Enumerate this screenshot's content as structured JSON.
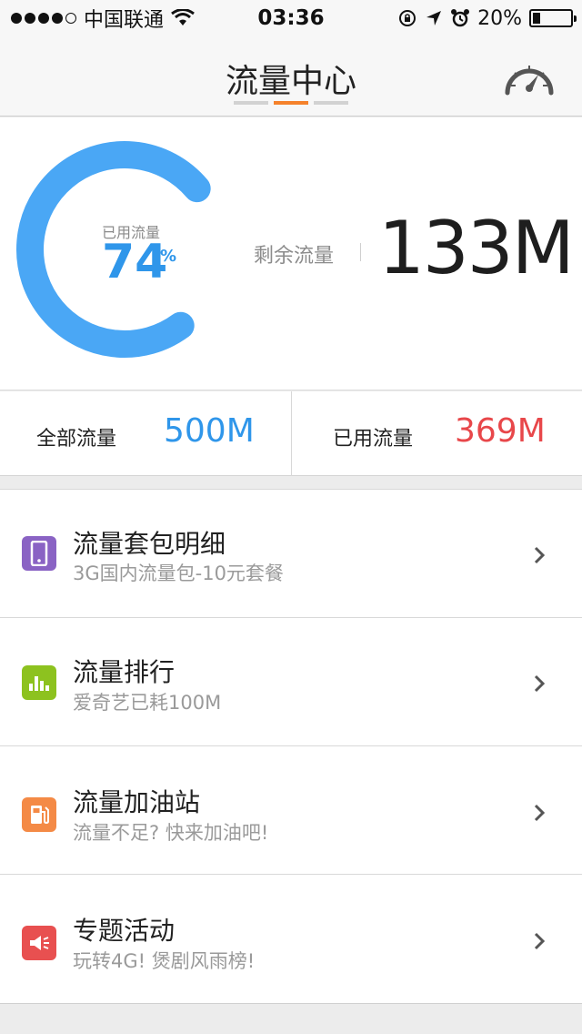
{
  "status_bar": {
    "carrier": "中国联通",
    "time": "03:36",
    "battery": "20%",
    "battery_level": 0.2
  },
  "nav": {
    "title": "流量中心",
    "page_count": 3,
    "active_page": 2
  },
  "usage": {
    "used_caption": "已用流量",
    "used_percent": "74",
    "percent_sign": "%",
    "used_fraction": 0.74,
    "remaining_label": "剩余流量",
    "remaining_value": "133M",
    "ring_color": "#4aa7f5"
  },
  "totals": {
    "total_label": "全部流量",
    "total_value": "500M",
    "used_label": "已用流量",
    "used_value": "369M"
  },
  "menu": [
    {
      "icon": "phone-icon",
      "color": "#8a63c4",
      "title": "流量套包明细",
      "subtitle": "3G国内流量包-10元套餐"
    },
    {
      "icon": "bar-chart-icon",
      "color": "#8dc21f",
      "title": "流量排行",
      "subtitle": "爱奇艺已耗100M"
    },
    {
      "icon": "gas-station-icon",
      "color": "#f48a46",
      "title": "流量加油站",
      "subtitle": "流量不足? 快来加油吧!"
    },
    {
      "icon": "megaphone-icon",
      "color": "#e85050",
      "title": "专题活动",
      "subtitle": "玩转4G! 煲剧风雨榜!"
    }
  ]
}
